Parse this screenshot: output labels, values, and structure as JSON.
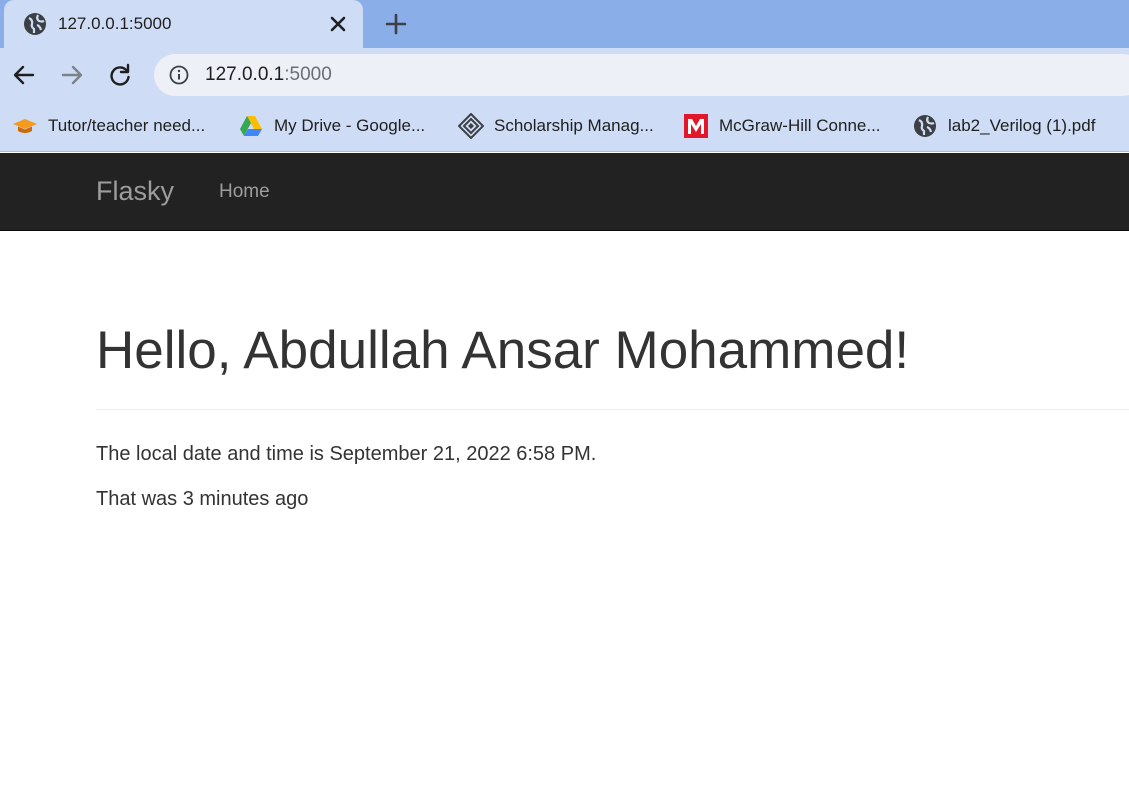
{
  "browser": {
    "tab": {
      "title": "127.0.0.1:5000"
    },
    "address_bar": {
      "host": "127.0.0.1",
      "port": ":5000"
    },
    "bookmarks": [
      {
        "label": "Tutor/teacher need...",
        "icon": "graduation-cap-icon"
      },
      {
        "label": "My Drive - Google...",
        "icon": "google-drive-icon"
      },
      {
        "label": "Scholarship Manag...",
        "icon": "diamond-icon"
      },
      {
        "label": "McGraw-Hill Conne...",
        "icon": "mcgraw-hill-icon"
      },
      {
        "label": "lab2_Verilog (1).pdf",
        "icon": "globe-icon"
      }
    ]
  },
  "navbar": {
    "brand": "Flasky",
    "links": [
      {
        "label": "Home"
      }
    ]
  },
  "main": {
    "heading": "Hello, Abdullah Ansar Mohammed!",
    "datetime_text": "The local date and time is September 21, 2022 6:58 PM.",
    "relative_text": "That was 3 minutes ago"
  },
  "colors": {
    "tabstrip": "#8aaee8",
    "chrome": "#cfdcf6",
    "navbar": "#222222",
    "navbar_text": "#9d9d9d",
    "body_text": "#333333"
  }
}
